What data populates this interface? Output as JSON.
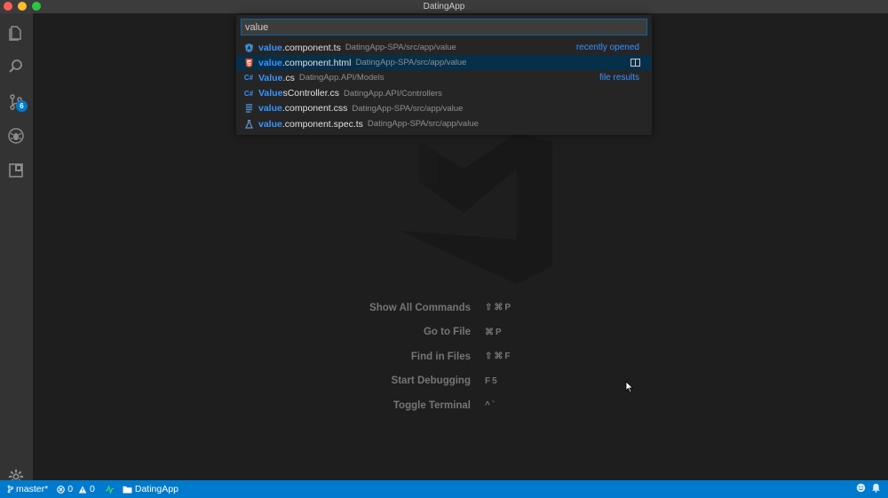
{
  "window": {
    "title": "DatingApp"
  },
  "quick_open": {
    "query": "value",
    "groups": {
      "recent": "recently opened",
      "files": "file results"
    },
    "items": [
      {
        "highlight": "value",
        "rest": ".component.ts",
        "path": "DatingApp-SPA/src/app/value",
        "icon": "angular-icon",
        "icon_color": "#3b8fd6"
      },
      {
        "highlight": "value",
        "rest": ".component.html",
        "path": "DatingApp-SPA/src/app/value",
        "icon": "html-icon",
        "icon_color": "#e44d26"
      },
      {
        "highlight": "Value",
        "rest": ".cs",
        "path": "DatingApp.API/Models",
        "icon": "csharp-icon",
        "icon_color": "#3794ff"
      },
      {
        "highlight": "Value",
        "rest": "sController.cs",
        "path": "DatingApp.API/Controllers",
        "icon": "csharp-icon",
        "icon_color": "#3794ff"
      },
      {
        "highlight": "value",
        "rest": ".component.css",
        "path": "DatingApp-SPA/src/app/value",
        "icon": "css-icon",
        "icon_color": "#4f8fd6"
      },
      {
        "highlight": "value",
        "rest": ".component.spec.ts",
        "path": "DatingApp-SPA/src/app/value",
        "icon": "flask-icon",
        "icon_color": "#6a9fd8"
      }
    ]
  },
  "activity": {
    "scm_badge": "6"
  },
  "shortcuts": [
    {
      "label": "Show All Commands",
      "keys": "⇧⌘P"
    },
    {
      "label": "Go to File",
      "keys": "⌘P"
    },
    {
      "label": "Find in Files",
      "keys": "⇧⌘F"
    },
    {
      "label": "Start Debugging",
      "keys": "F5"
    },
    {
      "label": "Toggle Terminal",
      "keys": "^`"
    }
  ],
  "statusbar": {
    "branch": "master*",
    "errors": "0",
    "warnings": "0",
    "folder": "DatingApp"
  },
  "colors": {
    "accent": "#007acc",
    "highlight": "#3794ff",
    "selection": "#062f4a"
  }
}
